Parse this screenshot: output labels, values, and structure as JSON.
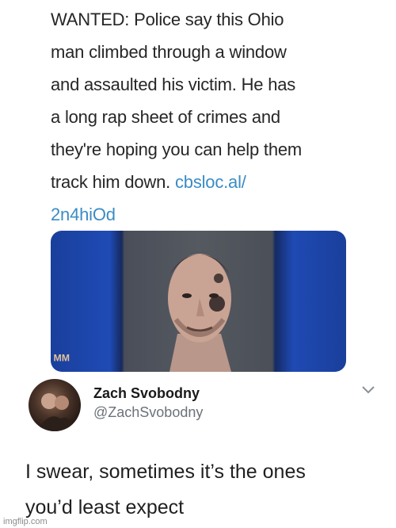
{
  "post": {
    "text_lines": [
      "WANTED:  Police say this Ohio",
      "man climbed through a window",
      "and assaulted his victim.  He has",
      "a long rap sheet of crimes and",
      "they're hoping you can help them",
      "track him down."
    ],
    "link_part1": "cbsloc.al/",
    "link_part2": "2n4hiOd",
    "photo_mark": "ᴹᴹ"
  },
  "reply": {
    "display_name": "Zach Svobodny",
    "handle": "@ZachSvobodny",
    "text_lines": [
      "I swear, sometimes it’s the ones",
      "you’d least expect"
    ]
  },
  "watermark": "imgflip.com",
  "icons": {
    "chevron": "chevron-down-icon"
  },
  "colors": {
    "link": "#3b8cc4",
    "handle": "#6b7278"
  }
}
